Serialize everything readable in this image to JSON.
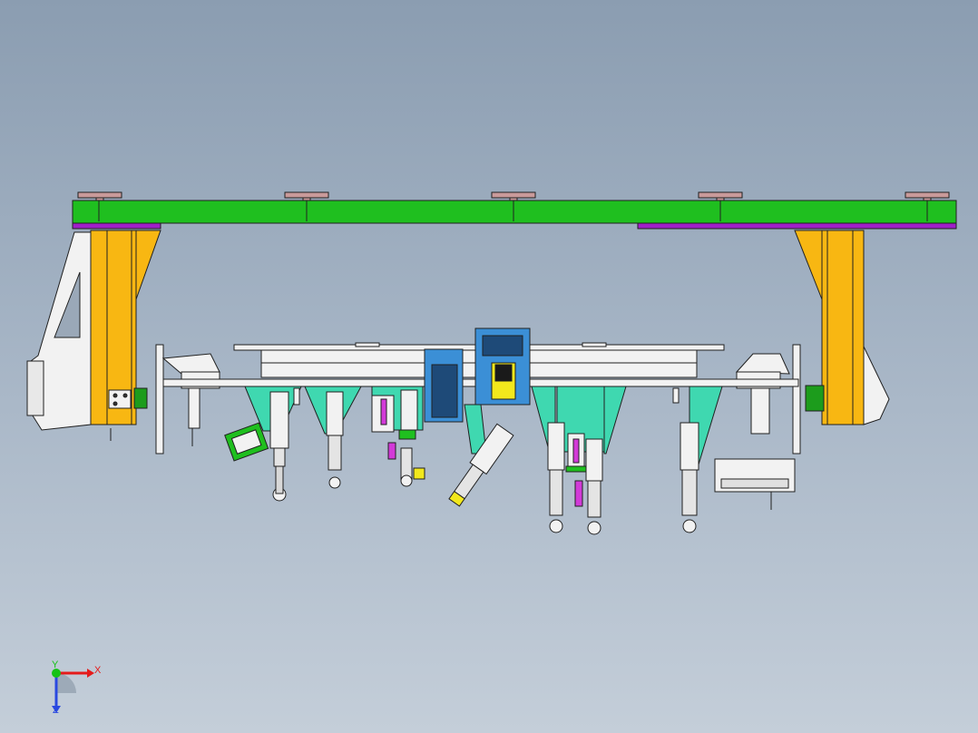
{
  "viewport": {
    "background_top": "#8b9db1",
    "background_bottom": "#c4ced9"
  },
  "model": {
    "description_icon": "cad-assembly",
    "colors": {
      "beam_green": "#1fbf1f",
      "strip_purple": "#a020c8",
      "column_yellow": "#f8b712",
      "plate_white": "#f2f2f2",
      "bracket_teal": "#3fd8b0",
      "box_blue": "#3b8fd6",
      "cable_yellow": "#f2e81c",
      "mount_pink": "#c99a9a",
      "label_magenta": "#d23ad8",
      "outline": "#202020"
    }
  },
  "triad": {
    "x_label": "X",
    "y_label": "Y",
    "z_label": "Z",
    "x_color": "#e51b1b",
    "y_color": "#16c216",
    "z_color": "#2a49e0"
  }
}
